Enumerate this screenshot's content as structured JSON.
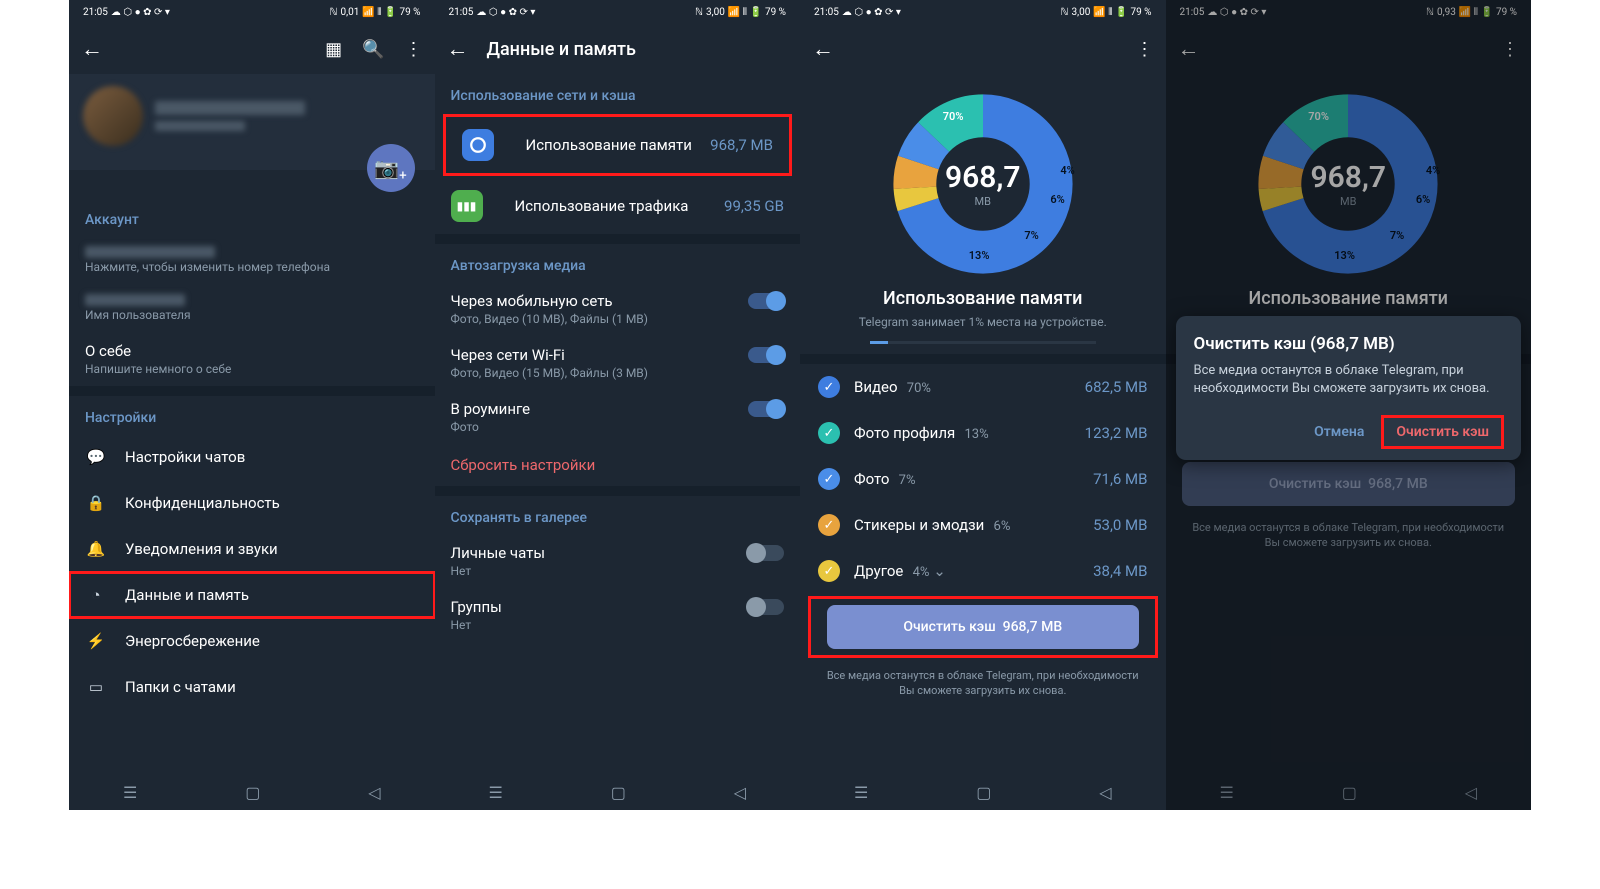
{
  "status": {
    "time": "21:05",
    "kb1": "0,01",
    "kb2": "3,00",
    "kb3": "0,93",
    "batt": "79 %"
  },
  "p1": {
    "account_header": "Аккаунт",
    "phone_hint": "Нажмите, чтобы изменить номер телефона",
    "username_hint": "Имя пользователя",
    "about": "О себе",
    "about_hint": "Напишите немного о себе",
    "settings_header": "Настройки",
    "items": [
      "Настройки чатов",
      "Конфиденциальность",
      "Уведомления и звуки",
      "Данные и память",
      "Энергосбережение",
      "Папки с чатами"
    ]
  },
  "p2": {
    "title": "Данные и память",
    "sec1": "Использование сети и кэша",
    "storage": "Использование памяти",
    "storage_val": "968,7 MB",
    "traffic": "Использование трафика",
    "traffic_val": "99,35 GB",
    "sec2": "Автозагрузка медиа",
    "mobile": "Через мобильную сеть",
    "mobile_sub": "Фото, Видео (10 MB), Файлы (1 MB)",
    "wifi": "Через сети Wi-Fi",
    "wifi_sub": "Фото, Видео (15 MB), Файлы (3 MB)",
    "roaming": "В роуминге",
    "roaming_sub": "Фото",
    "reset": "Сбросить настройки",
    "sec3": "Сохранять в галерее",
    "private": "Личные чаты",
    "groups": "Группы",
    "no": "Нет"
  },
  "p3": {
    "total": "968,7",
    "unit": "MB",
    "title": "Использование памяти",
    "sub": "Telegram занимает 1% места на устройстве.",
    "cats": [
      {
        "name": "Видео",
        "pct": "70%",
        "val": "682,5 MB",
        "color": "c-blue"
      },
      {
        "name": "Фото профиля",
        "pct": "13%",
        "val": "123,2 MB",
        "color": "c-teal"
      },
      {
        "name": "Фото",
        "pct": "7%",
        "val": "71,6 MB",
        "color": "c-blue2"
      },
      {
        "name": "Стикеры и эмодзи",
        "pct": "6%",
        "val": "53,0 MB",
        "color": "c-orange"
      },
      {
        "name": "Другое",
        "pct": "4%",
        "val": "38,4 MB",
        "color": "c-yellow"
      }
    ],
    "clear": "Очистить кэш",
    "clear_val": "968,7 MB",
    "footer": "Все медиа останутся в облаке Telegram, при необходимости Вы сможете загрузить их снова."
  },
  "p4": {
    "dialog_title": "Очистить кэш (968,7 MB)",
    "dialog_body": "Все медиа останутся в облаке Telegram, при необходимости Вы сможете загрузить их снова.",
    "cancel": "Отмена",
    "confirm": "Очистить кэш"
  },
  "chart_data": {
    "type": "pie",
    "title": "Использование памяти",
    "unit": "MB",
    "total": 968.7,
    "series": [
      {
        "name": "Видео",
        "value": 682.5,
        "pct": 70
      },
      {
        "name": "Фото профиля",
        "value": 123.2,
        "pct": 13
      },
      {
        "name": "Фото",
        "value": 71.6,
        "pct": 7
      },
      {
        "name": "Стикеры и эмодзи",
        "value": 53.0,
        "pct": 6
      },
      {
        "name": "Другое",
        "value": 38.4,
        "pct": 4
      }
    ]
  }
}
